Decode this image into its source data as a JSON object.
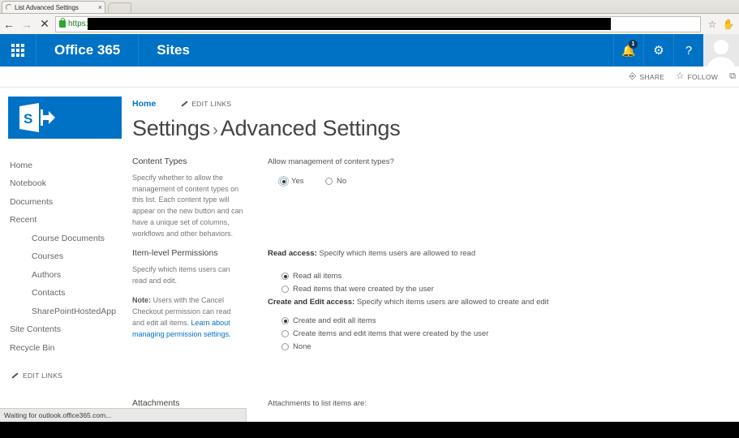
{
  "browser": {
    "tab_title": "List Advanced Settings",
    "tab_close": "×",
    "back": "←",
    "forward": "→",
    "stop": "✕",
    "url_scheme": "https:",
    "url_redacted": "",
    "bookmark_icon": "☆",
    "extension_icon": "✋"
  },
  "suite": {
    "waffle_name": "app-launcher",
    "brand": "Office 365",
    "app": "Sites",
    "notifications_count": "1",
    "gear": "⚙",
    "help": "?"
  },
  "actions": {
    "share": "SHARE",
    "follow": "FOLLOW",
    "more": "⚙"
  },
  "header": {
    "breadcrumb_home": "Home",
    "edit_links": "EDIT LINKS",
    "title_part1": "Settings",
    "title_sep": "›",
    "title_part2": "Advanced Settings"
  },
  "sidebar": {
    "items": [
      {
        "label": "Home",
        "sub": false
      },
      {
        "label": "Notebook",
        "sub": false
      },
      {
        "label": "Documents",
        "sub": false
      },
      {
        "label": "Recent",
        "sub": false
      },
      {
        "label": "Course Documents",
        "sub": true
      },
      {
        "label": "Courses",
        "sub": true
      },
      {
        "label": "Authors",
        "sub": true
      },
      {
        "label": "Contacts",
        "sub": true
      },
      {
        "label": "SharePointHostedApp",
        "sub": true
      },
      {
        "label": "Site Contents",
        "sub": false
      },
      {
        "label": "Recycle Bin",
        "sub": false
      }
    ],
    "edit_links": "EDIT LINKS"
  },
  "settings": {
    "content_types": {
      "title": "Content Types",
      "description": "Specify whether to allow the management of content types on this list. Each content type will appear on the new button and can have a unique set of columns, workflows and other behaviors.",
      "question": "Allow management of content types?",
      "option_yes": "Yes",
      "option_no": "No",
      "selected": "Yes"
    },
    "item_level_permissions": {
      "title": "Item-level Permissions",
      "description": "Specify which items users can read and edit.",
      "note_label": "Note:",
      "note_text": " Users with the Cancel Checkout permission can read and edit all items. ",
      "note_link": "Learn about managing permission settings.",
      "read_access_label": "Read access:",
      "read_access_desc": "  Specify which items users are allowed to read",
      "read_options": [
        {
          "label": "Read all items",
          "selected": true
        },
        {
          "label": "Read items that were created by the user",
          "selected": false
        }
      ],
      "create_edit_label": "Create and Edit access:",
      "create_edit_desc": "  Specify which items users are allowed to create and edit",
      "create_options": [
        {
          "label": "Create and edit all items",
          "selected": true
        },
        {
          "label": "Create items and edit items that were created by the user",
          "selected": false
        },
        {
          "label": "None",
          "selected": false
        }
      ]
    },
    "attachments": {
      "title": "Attachments",
      "question": "Attachments to list items are:"
    }
  },
  "status": {
    "text": "Waiting for outlook.office365.com..."
  }
}
